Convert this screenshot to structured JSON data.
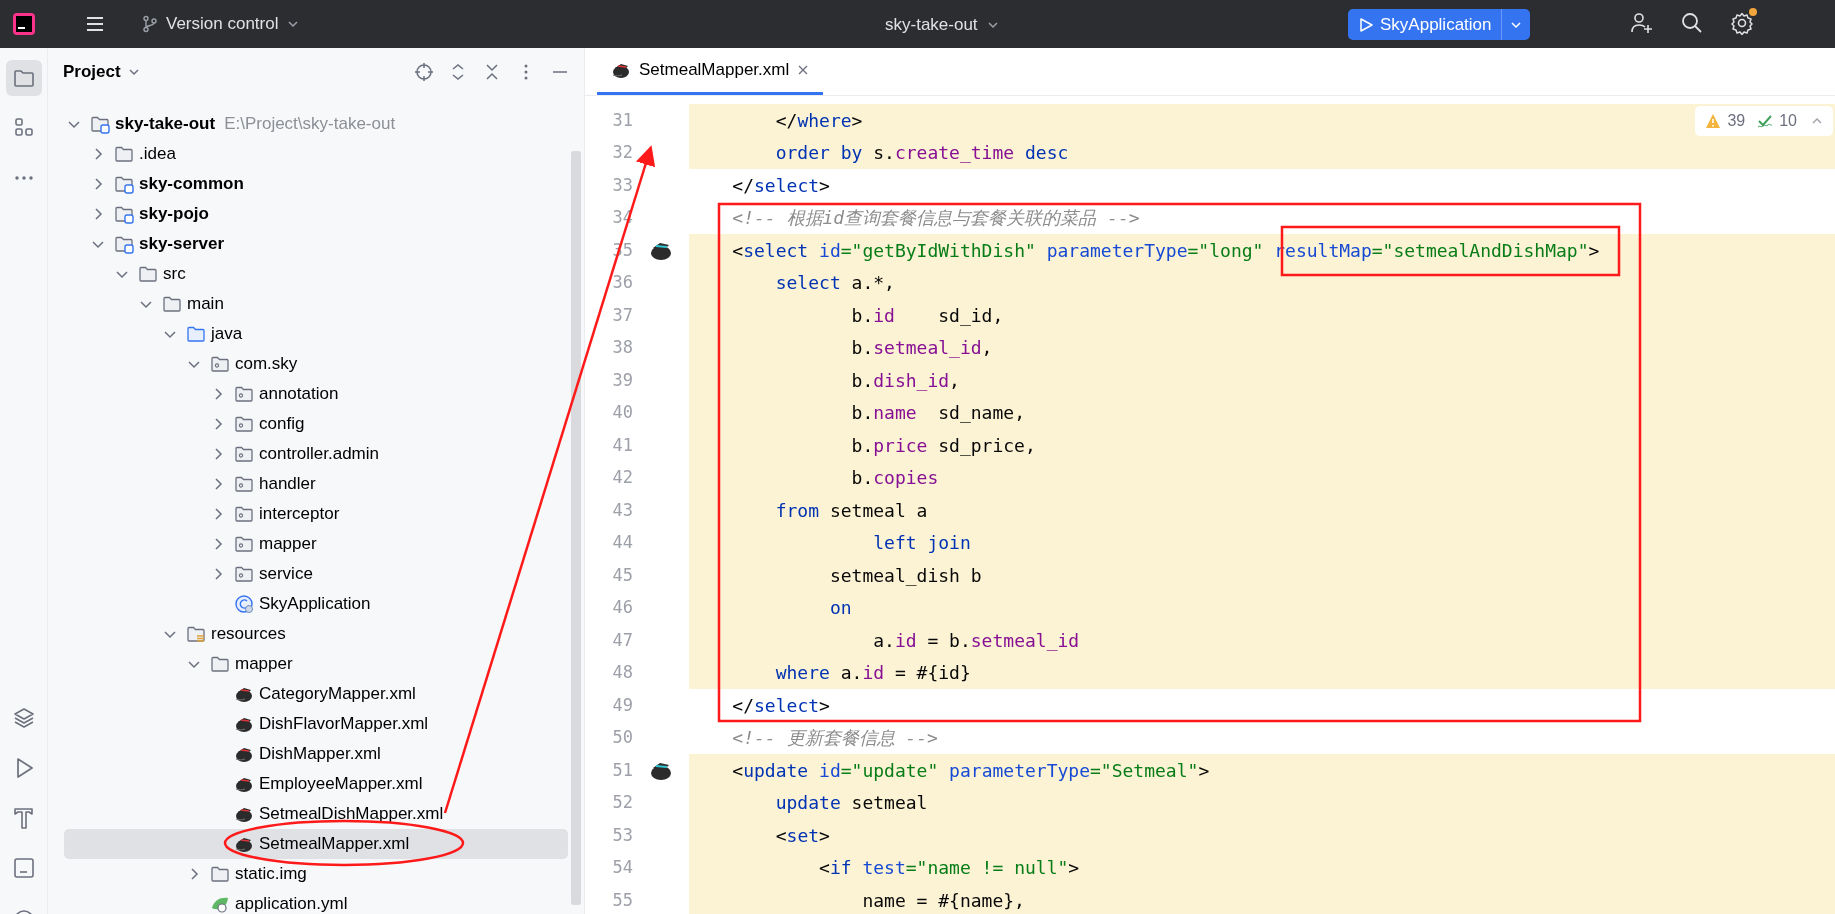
{
  "title_bar": {
    "vcs": "Version control",
    "project": "sky-take-out",
    "run_config": "SkyApplication",
    "settings_badge": true
  },
  "tool_windows": {
    "top": [
      {
        "kind": "project",
        "selected": true
      },
      {
        "kind": "structure",
        "selected": false
      },
      {
        "kind": "more",
        "selected": false
      }
    ],
    "bottom": [
      {
        "kind": "layers",
        "selected": false
      },
      {
        "kind": "run",
        "selected": false
      },
      {
        "kind": "build",
        "selected": false
      },
      {
        "kind": "terminal",
        "selected": false
      },
      {
        "kind": "problems",
        "selected": false
      }
    ]
  },
  "project_panel": {
    "title": "Project",
    "tree": [
      {
        "label": "sky-take-out",
        "hint": "E:\\Project\\sky-take-out",
        "kind": "module",
        "expanded": true,
        "selected": false,
        "children": [
          {
            "label": ".idea",
            "kind": "folder",
            "expanded": false,
            "selected": false
          },
          {
            "label": "sky-common",
            "kind": "module",
            "expanded": false,
            "selected": false
          },
          {
            "label": "sky-pojo",
            "kind": "module",
            "expanded": false,
            "selected": false
          },
          {
            "label": "sky-server",
            "kind": "module",
            "expanded": true,
            "selected": false,
            "children": [
              {
                "label": "src",
                "kind": "folder",
                "expanded": true,
                "selected": false,
                "children": [
                  {
                    "label": "main",
                    "kind": "folder",
                    "expanded": true,
                    "selected": false,
                    "children": [
                      {
                        "label": "java",
                        "kind": "source_root",
                        "expanded": true,
                        "selected": false,
                        "children": [
                          {
                            "label": "com.sky",
                            "kind": "package",
                            "expanded": true,
                            "selected": false,
                            "children": [
                              {
                                "label": "annotation",
                                "kind": "package",
                                "expanded": false,
                                "selected": false
                              },
                              {
                                "label": "config",
                                "kind": "package",
                                "expanded": false,
                                "selected": false
                              },
                              {
                                "label": "controller.admin",
                                "kind": "package",
                                "expanded": false,
                                "selected": false
                              },
                              {
                                "label": "handler",
                                "kind": "package",
                                "expanded": false,
                                "selected": false
                              },
                              {
                                "label": "interceptor",
                                "kind": "package",
                                "expanded": false,
                                "selected": false
                              },
                              {
                                "label": "mapper",
                                "kind": "package",
                                "expanded": false,
                                "selected": false
                              },
                              {
                                "label": "service",
                                "kind": "package",
                                "expanded": false,
                                "selected": false
                              },
                              {
                                "label": "SkyApplication",
                                "kind": "class",
                                "selected": false
                              }
                            ]
                          }
                        ]
                      },
                      {
                        "label": "resources",
                        "kind": "resources_root",
                        "expanded": true,
                        "selected": false,
                        "children": [
                          {
                            "label": "mapper",
                            "kind": "folder",
                            "expanded": true,
                            "selected": false,
                            "children": [
                              {
                                "label": "CategoryMapper.xml",
                                "kind": "mybatis_xml",
                                "selected": false
                              },
                              {
                                "label": "DishFlavorMapper.xml",
                                "kind": "mybatis_xml",
                                "selected": false
                              },
                              {
                                "label": "DishMapper.xml",
                                "kind": "mybatis_xml",
                                "selected": false
                              },
                              {
                                "label": "EmployeeMapper.xml",
                                "kind": "mybatis_xml",
                                "selected": false
                              },
                              {
                                "label": "SetmealDishMapper.xml",
                                "kind": "mybatis_xml",
                                "selected": false
                              },
                              {
                                "label": "SetmealMapper.xml",
                                "kind": "mybatis_xml",
                                "selected": true
                              }
                            ]
                          },
                          {
                            "label": "static.img",
                            "kind": "folder",
                            "expanded": false,
                            "selected": false
                          },
                          {
                            "label": "application.yml",
                            "kind": "yaml",
                            "selected": false
                          }
                        ]
                      }
                    ]
                  }
                ]
              }
            ]
          }
        ]
      }
    ]
  },
  "editor": {
    "tabs": [
      {
        "label": "SetmealMapper.xml",
        "selected": true
      }
    ],
    "inspections": {
      "warnings": "39",
      "weak_warnings": "10"
    },
    "lines": [
      {
        "number": "31",
        "highlighted": true,
        "gutter_icon": false,
        "tokens": [
          {
            "kind": "plain",
            "text": "        </"
          },
          {
            "kind": "tag",
            "text": "where"
          },
          {
            "kind": "plain",
            "text": ">"
          }
        ]
      },
      {
        "number": "32",
        "highlighted": true,
        "gutter_icon": false,
        "tokens": [
          {
            "kind": "keyword",
            "text": "        order by"
          },
          {
            "kind": "plain",
            "text": " s."
          },
          {
            "kind": "field",
            "text": "create_time"
          },
          {
            "kind": "keyword",
            "text": " desc"
          }
        ]
      },
      {
        "number": "33",
        "highlighted": false,
        "gutter_icon": false,
        "tokens": [
          {
            "kind": "plain",
            "text": "    </"
          },
          {
            "kind": "tag",
            "text": "select"
          },
          {
            "kind": "plain",
            "text": ">"
          }
        ]
      },
      {
        "number": "34",
        "highlighted": false,
        "gutter_icon": false,
        "tokens": [
          {
            "kind": "comment",
            "text": "    <!-- 根据id查询套餐信息与套餐关联的菜品 -->"
          }
        ]
      },
      {
        "number": "35",
        "highlighted": true,
        "gutter_icon": true,
        "tokens": [
          {
            "kind": "plain",
            "text": "    <"
          },
          {
            "kind": "tag",
            "text": "select"
          },
          {
            "kind": "attr",
            "text": " id"
          },
          {
            "kind": "string",
            "text": "=\"getByIdWithDish\""
          },
          {
            "kind": "attr",
            "text": " parameterType"
          },
          {
            "kind": "string",
            "text": "=\"long\""
          },
          {
            "kind": "attr",
            "text": " resultMap"
          },
          {
            "kind": "string",
            "text": "=\"setmealAndDishMap\""
          },
          {
            "kind": "plain",
            "text": ">"
          }
        ]
      },
      {
        "number": "36",
        "highlighted": true,
        "gutter_icon": false,
        "tokens": [
          {
            "kind": "keyword",
            "text": "        select"
          },
          {
            "kind": "plain",
            "text": " a.*,"
          }
        ]
      },
      {
        "number": "37",
        "highlighted": true,
        "gutter_icon": false,
        "tokens": [
          {
            "kind": "plain",
            "text": "               b."
          },
          {
            "kind": "field",
            "text": "id"
          },
          {
            "kind": "plain",
            "text": "    sd_id,"
          }
        ]
      },
      {
        "number": "38",
        "highlighted": true,
        "gutter_icon": false,
        "tokens": [
          {
            "kind": "plain",
            "text": "               b."
          },
          {
            "kind": "field",
            "text": "setmeal_id"
          },
          {
            "kind": "plain",
            "text": ","
          }
        ]
      },
      {
        "number": "39",
        "highlighted": true,
        "gutter_icon": false,
        "tokens": [
          {
            "kind": "plain",
            "text": "               b."
          },
          {
            "kind": "field",
            "text": "dish_id"
          },
          {
            "kind": "plain",
            "text": ","
          }
        ]
      },
      {
        "number": "40",
        "highlighted": true,
        "gutter_icon": false,
        "tokens": [
          {
            "kind": "plain",
            "text": "               b."
          },
          {
            "kind": "field",
            "text": "name"
          },
          {
            "kind": "plain",
            "text": "  sd_name,"
          }
        ]
      },
      {
        "number": "41",
        "highlighted": true,
        "gutter_icon": false,
        "tokens": [
          {
            "kind": "plain",
            "text": "               b."
          },
          {
            "kind": "field",
            "text": "price"
          },
          {
            "kind": "plain",
            "text": " sd_price,"
          }
        ]
      },
      {
        "number": "42",
        "highlighted": true,
        "gutter_icon": false,
        "tokens": [
          {
            "kind": "plain",
            "text": "               b."
          },
          {
            "kind": "field",
            "text": "copies"
          }
        ]
      },
      {
        "number": "43",
        "highlighted": true,
        "gutter_icon": false,
        "tokens": [
          {
            "kind": "keyword",
            "text": "        from"
          },
          {
            "kind": "plain",
            "text": " setmeal a"
          }
        ]
      },
      {
        "number": "44",
        "highlighted": true,
        "gutter_icon": false,
        "tokens": [
          {
            "kind": "keyword",
            "text": "                 left join"
          }
        ]
      },
      {
        "number": "45",
        "highlighted": true,
        "gutter_icon": false,
        "tokens": [
          {
            "kind": "plain",
            "text": "             setmeal_dish b"
          }
        ]
      },
      {
        "number": "46",
        "highlighted": true,
        "gutter_icon": false,
        "tokens": [
          {
            "kind": "keyword",
            "text": "             on"
          }
        ]
      },
      {
        "number": "47",
        "highlighted": true,
        "gutter_icon": false,
        "tokens": [
          {
            "kind": "plain",
            "text": "                 a."
          },
          {
            "kind": "field",
            "text": "id"
          },
          {
            "kind": "plain",
            "text": " = b."
          },
          {
            "kind": "field",
            "text": "setmeal_id"
          }
        ]
      },
      {
        "number": "48",
        "highlighted": true,
        "gutter_icon": false,
        "tokens": [
          {
            "kind": "keyword",
            "text": "        where"
          },
          {
            "kind": "plain",
            "text": " a."
          },
          {
            "kind": "field",
            "text": "id"
          },
          {
            "kind": "plain",
            "text": " = #{id}"
          }
        ]
      },
      {
        "number": "49",
        "highlighted": false,
        "gutter_icon": false,
        "tokens": [
          {
            "kind": "plain",
            "text": "    </"
          },
          {
            "kind": "tag",
            "text": "select"
          },
          {
            "kind": "plain",
            "text": ">"
          }
        ]
      },
      {
        "number": "50",
        "highlighted": false,
        "gutter_icon": false,
        "tokens": [
          {
            "kind": "comment",
            "text": "    <!-- 更新套餐信息 -->"
          }
        ]
      },
      {
        "number": "51",
        "highlighted": true,
        "gutter_icon": true,
        "tokens": [
          {
            "kind": "plain",
            "text": "    <"
          },
          {
            "kind": "tag",
            "text": "update"
          },
          {
            "kind": "attr",
            "text": " id"
          },
          {
            "kind": "string",
            "text": "=\"update\""
          },
          {
            "kind": "attr",
            "text": " parameterType"
          },
          {
            "kind": "string",
            "text": "=\"Setmeal\""
          },
          {
            "kind": "plain",
            "text": ">"
          }
        ]
      },
      {
        "number": "52",
        "highlighted": true,
        "gutter_icon": false,
        "tokens": [
          {
            "kind": "keyword",
            "text": "        update"
          },
          {
            "kind": "plain",
            "text": " setmeal"
          }
        ]
      },
      {
        "number": "53",
        "highlighted": true,
        "gutter_icon": false,
        "tokens": [
          {
            "kind": "plain",
            "text": "        <"
          },
          {
            "kind": "tag",
            "text": "set"
          },
          {
            "kind": "plain",
            "text": ">"
          }
        ]
      },
      {
        "number": "54",
        "highlighted": true,
        "gutter_icon": false,
        "tokens": [
          {
            "kind": "plain",
            "text": "            <"
          },
          {
            "kind": "tag",
            "text": "if"
          },
          {
            "kind": "attr",
            "text": " test"
          },
          {
            "kind": "string",
            "text": "=\"name != null\""
          },
          {
            "kind": "plain",
            "text": ">"
          }
        ]
      },
      {
        "number": "55",
        "highlighted": true,
        "gutter_icon": false,
        "tokens": [
          {
            "kind": "plain",
            "text": "                name = #{name},"
          }
        ]
      }
    ]
  }
}
